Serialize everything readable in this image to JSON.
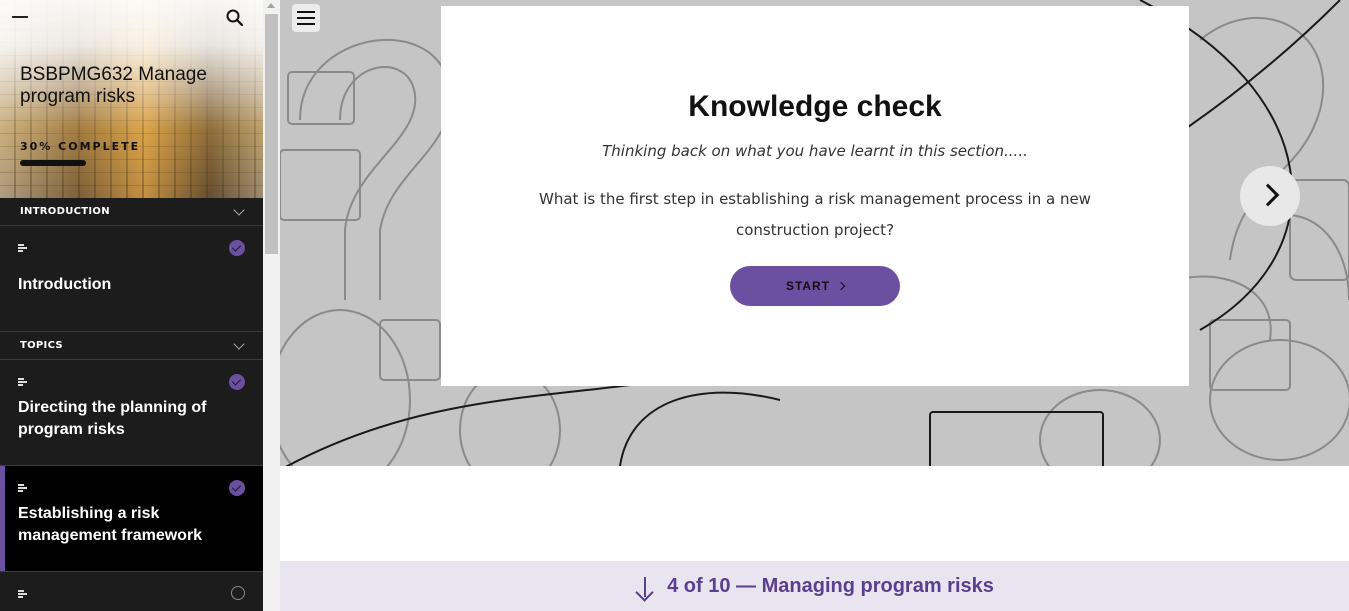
{
  "course": {
    "title": "BSBPMG632 Manage program risks",
    "progress_label": "30% COMPLETE",
    "progress_fraction": 0.3
  },
  "sidebar": {
    "sections": [
      {
        "label": "INTRODUCTION",
        "lessons": [
          {
            "title": "Introduction",
            "status": "complete"
          }
        ]
      },
      {
        "label": "TOPICS",
        "lessons": [
          {
            "title": "Directing the planning of program risks",
            "status": "complete"
          },
          {
            "title": "Establishing a risk management framework",
            "status": "complete",
            "active": true
          },
          {
            "title": "",
            "status": "incomplete"
          }
        ]
      }
    ]
  },
  "main": {
    "card": {
      "heading": "Knowledge check",
      "intro": "Thinking back on what you have learnt in this section.....",
      "question": "What is the first step in establishing a risk management process in a new construction project?",
      "start_label": "START"
    },
    "next_lesson_label": "4 of 10 — Managing program risks"
  },
  "icons": {
    "menu": "hamburger-menu-icon",
    "search": "search-icon",
    "next": "chevron-right-icon",
    "down": "arrow-down-icon",
    "lesson": "document-lines-icon",
    "complete": "check-circle-icon",
    "incomplete": "empty-circle-icon"
  },
  "colors": {
    "accent": "#6b4fa0",
    "sidebar_bg": "#1c1c1c",
    "footer_bg": "#e8e4f0"
  }
}
